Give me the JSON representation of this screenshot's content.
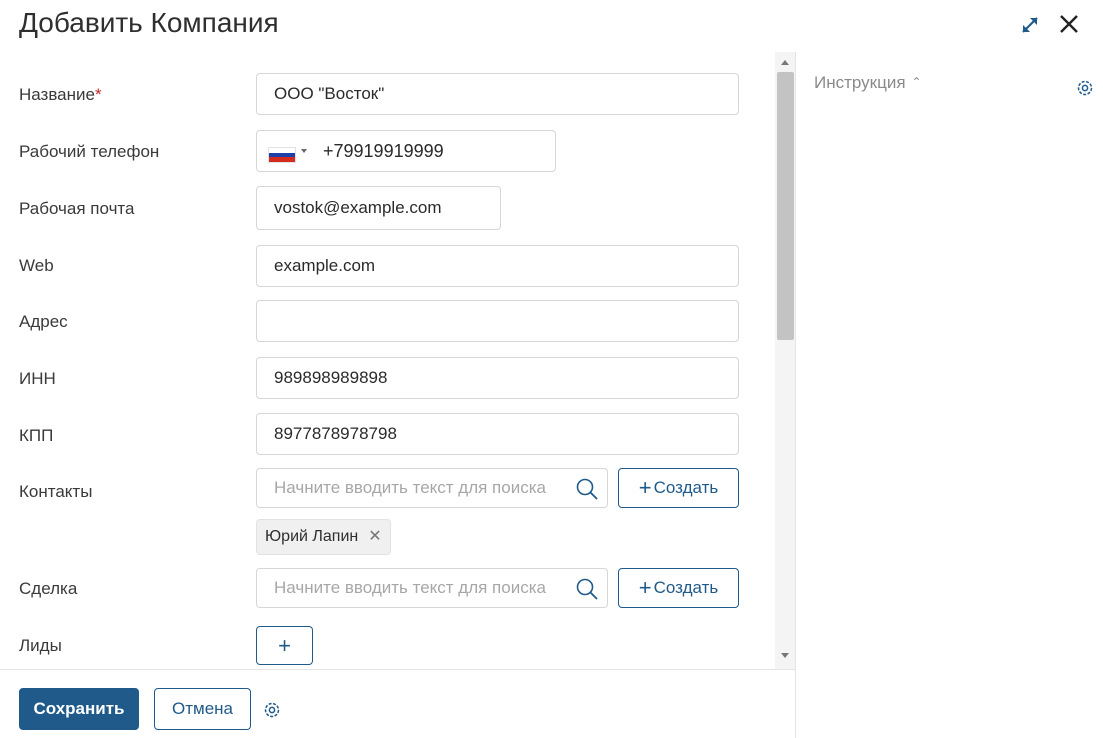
{
  "header": {
    "title": "Добавить Компания",
    "expand_icon": "expand-icon",
    "close_icon": "close-icon"
  },
  "form": {
    "name": {
      "label": "Название",
      "required_mark": "*",
      "value": "ООО \"Восток\""
    },
    "phone": {
      "label": "Рабочий телефон",
      "country": "ru",
      "value": "+79919919999"
    },
    "email": {
      "label": "Рабочая почта",
      "value": "vostok@example.com"
    },
    "web": {
      "label": "Web",
      "value": "example.com"
    },
    "address": {
      "label": "Адрес",
      "value": ""
    },
    "inn": {
      "label": "ИНН",
      "value": "989898989898"
    },
    "kpp": {
      "label": "КПП",
      "value": "8977878978798"
    },
    "contacts": {
      "label": "Контакты",
      "placeholder": "Начните вводить текст для поиска",
      "create_label": "Создать",
      "chips": [
        {
          "label": "Юрий Лапин"
        }
      ]
    },
    "deal": {
      "label": "Сделка",
      "placeholder": "Начните вводить текст для поиска",
      "create_label": "Создать"
    },
    "leads": {
      "label": "Лиды",
      "add_label": "+"
    }
  },
  "footer": {
    "save_label": "Сохранить",
    "cancel_label": "Отмена",
    "gear_icon": "gear-icon"
  },
  "sidebar": {
    "instruction_label": "Инструкция",
    "chevron": "⌃",
    "gear_icon": "gear-icon"
  },
  "colors": {
    "accent": "#1f5a8a",
    "required": "#c62828",
    "border": "#d6d6d6",
    "placeholder": "#a7a7a7"
  }
}
